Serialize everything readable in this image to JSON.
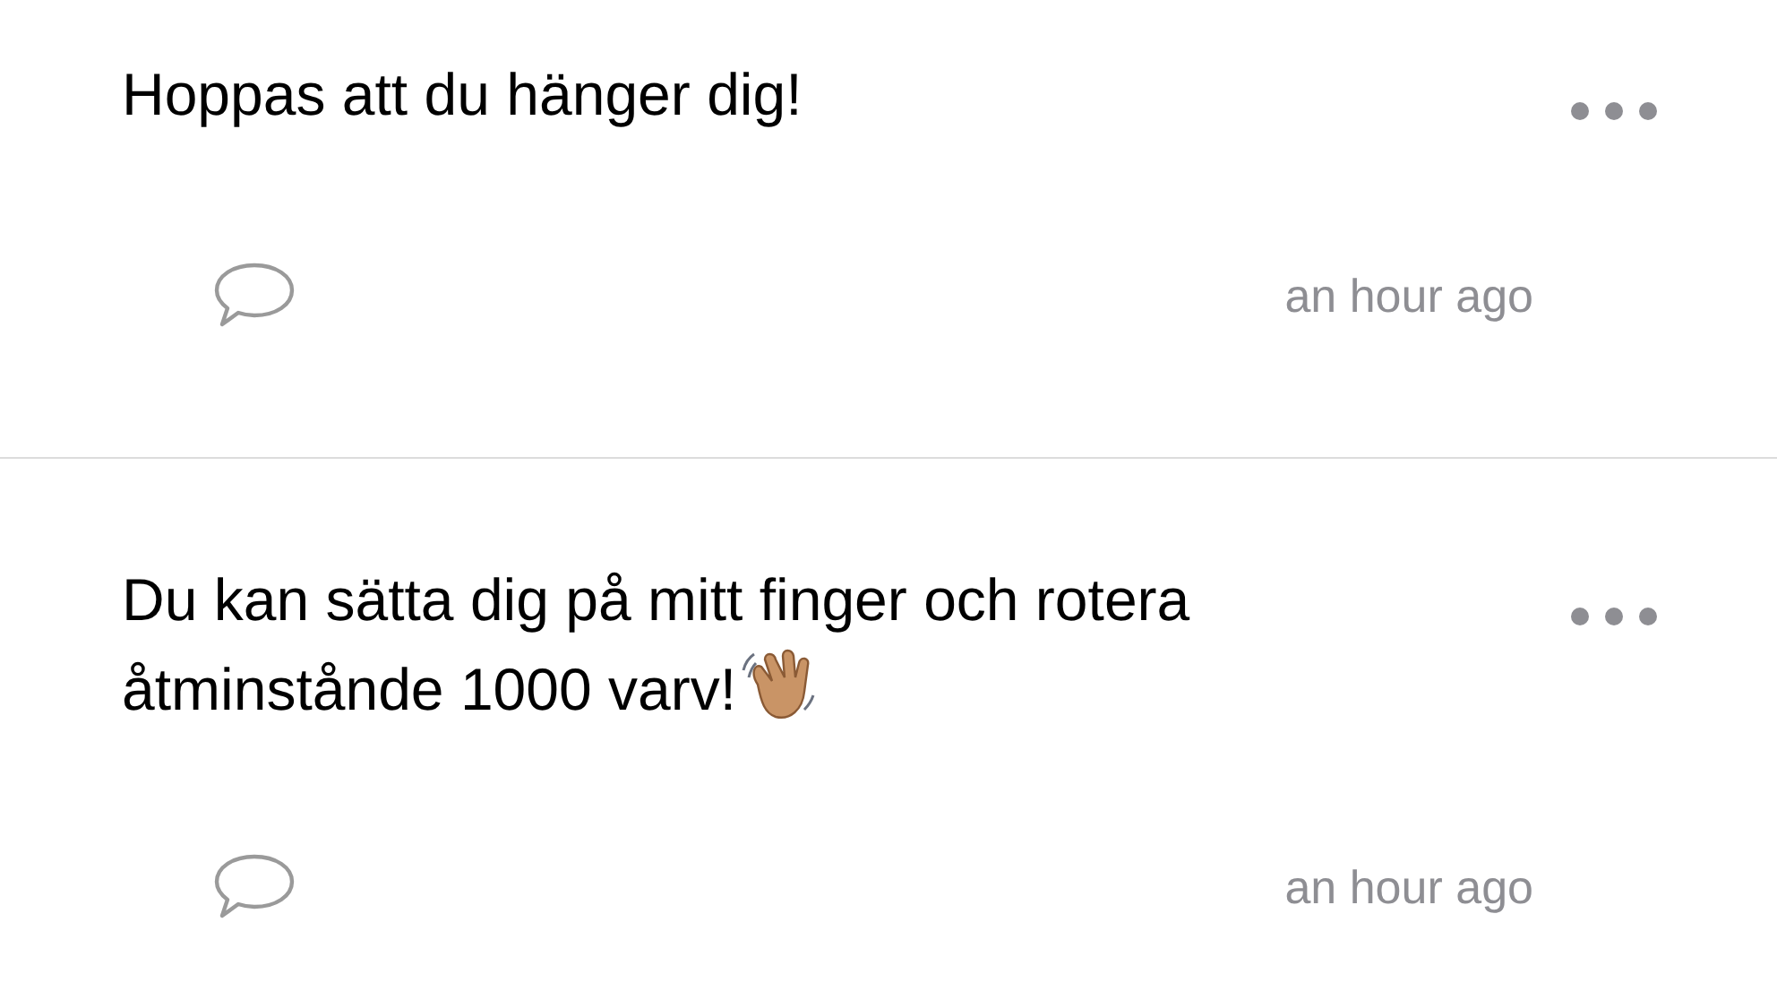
{
  "posts": [
    {
      "text": "Hoppas att du hänger dig!",
      "wave": false,
      "time": "an hour ago"
    },
    {
      "text": "Du kan sätta dig på mitt finger och rotera åtminstånde 1000 varv!",
      "wave": true,
      "time": "an hour ago"
    }
  ]
}
